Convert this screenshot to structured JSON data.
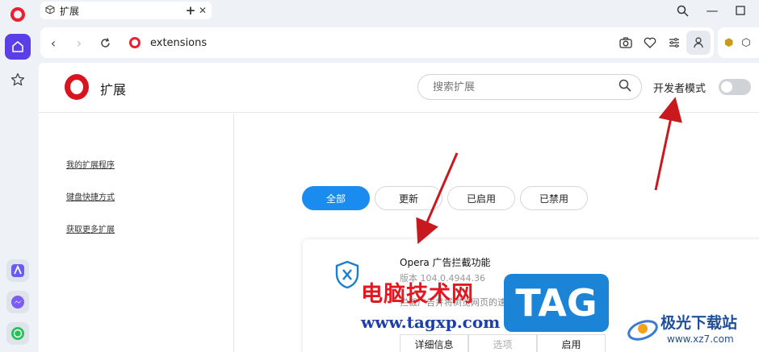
{
  "tab": {
    "title": "扩展"
  },
  "address": {
    "url": "extensions"
  },
  "header": {
    "title": "扩展",
    "search_placeholder": "搜索扩展",
    "developer_mode_label": "开发者模式",
    "developer_mode_on": false
  },
  "nav": {
    "items": [
      {
        "label": "我的扩展程序"
      },
      {
        "label": "键盘快捷方式"
      },
      {
        "label": "获取更多扩展"
      }
    ]
  },
  "filters": {
    "items": [
      {
        "label": "全部",
        "active": true
      },
      {
        "label": "更新",
        "active": false
      },
      {
        "label": "已启用",
        "active": false
      },
      {
        "label": "已禁用",
        "active": false
      }
    ]
  },
  "extension": {
    "name": "Opera 广告拦截功能",
    "version": "版本 104.0.4944.36",
    "description": "拦截广告并将浏览网页的速度提高三倍",
    "actions": [
      "详细信息",
      "选项",
      "启用"
    ]
  },
  "watermark": {
    "brand_cn": "电脑技术网",
    "brand_url": "www.tagxp.com",
    "tag": "TAG",
    "site_name": "极光下载站",
    "site_url": "www.xz7.com"
  },
  "colors": {
    "accent": "#1a8cf0",
    "opera_red": "#d9141f",
    "sidebar_active": "#5b3ee8"
  },
  "icons": {
    "sidebar": [
      "opera-logo-icon",
      "home-icon",
      "star-icon",
      "aria-icon",
      "messenger-icon",
      "whatsapp-icon"
    ],
    "toolbar": [
      "camera-icon",
      "heart-icon",
      "easy-setup-icon",
      "profile-icon"
    ]
  }
}
